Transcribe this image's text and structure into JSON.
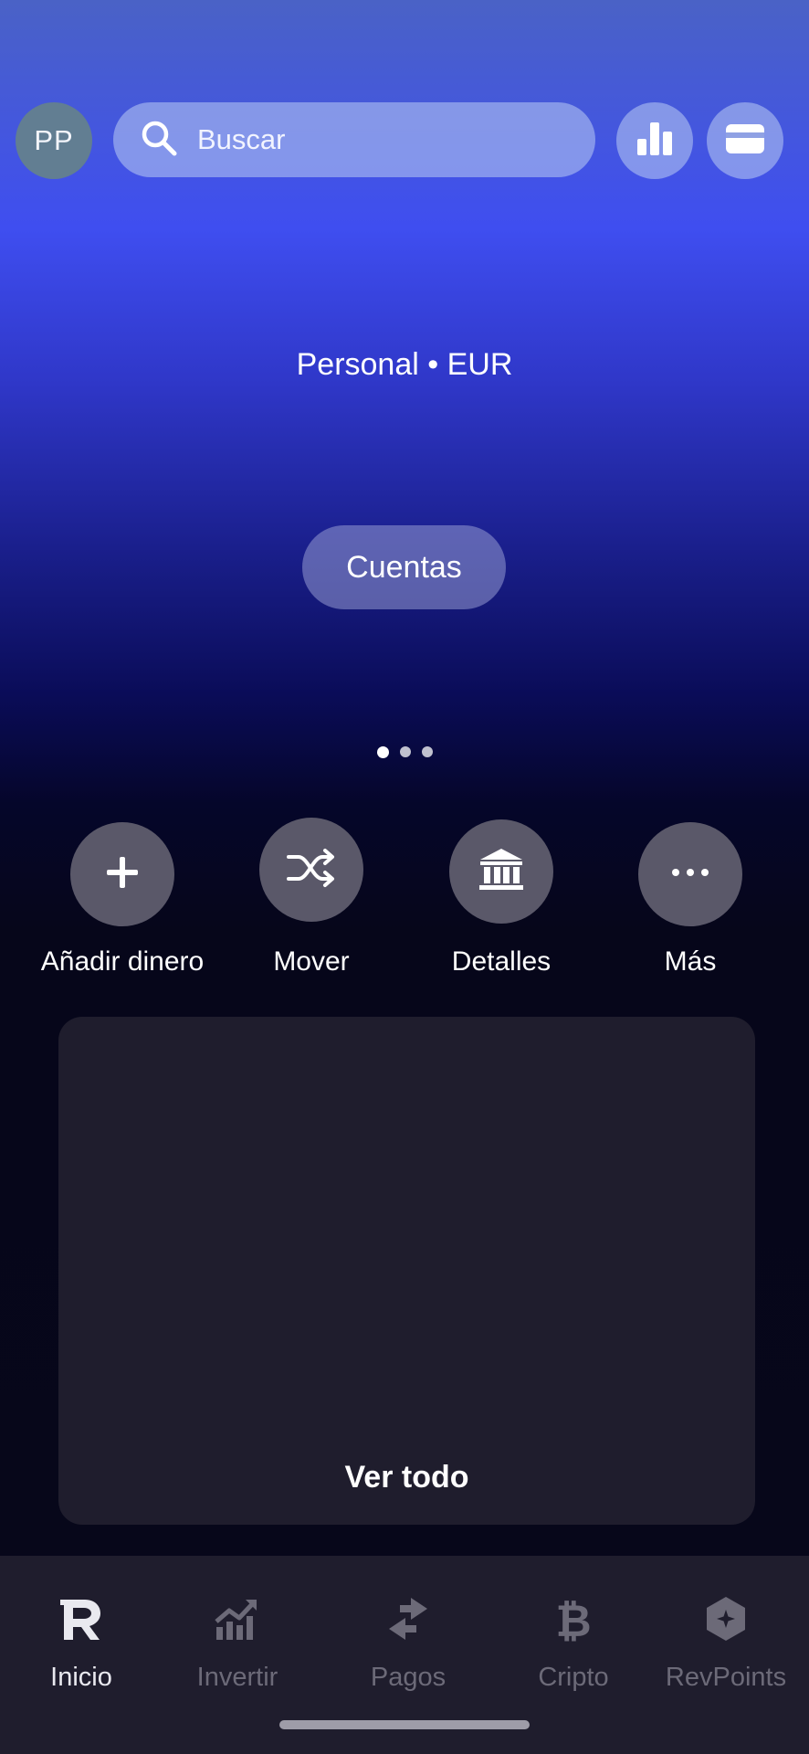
{
  "header": {
    "avatar_initials": "PP",
    "search": {
      "placeholder": "Buscar",
      "icon": "search-icon"
    },
    "stats_button_icon": "bar-chart-icon",
    "cards_button_icon": "card-icon"
  },
  "account": {
    "label": "Personal • EUR",
    "accounts_button": "Cuentas",
    "pager": {
      "pages": 3,
      "active_index": 0
    }
  },
  "actions": [
    {
      "label": "Añadir dinero",
      "icon": "plus-icon"
    },
    {
      "label": "Mover",
      "icon": "shuffle-icon"
    },
    {
      "label": "Detalles",
      "icon": "bank-icon"
    },
    {
      "label": "Más",
      "icon": "more-icon"
    }
  ],
  "transactions_panel": {
    "see_all": "Ver todo"
  },
  "tabbar": {
    "active": "Inicio",
    "tabs": [
      {
        "label": "Inicio",
        "icon": "revolut-r-icon"
      },
      {
        "label": "Invertir",
        "icon": "invest-chart-icon"
      },
      {
        "label": "Pagos",
        "icon": "transfer-arrows-icon"
      },
      {
        "label": "Cripto",
        "icon": "bitcoin-icon"
      },
      {
        "label": "RevPoints",
        "icon": "revpoints-hexagon-icon"
      }
    ]
  },
  "colors": {
    "accent_blue": "#3f4ef0",
    "panel": "#1f1d2d",
    "action_circle": "#5a5869",
    "tab_inactive": "#6c6a78"
  }
}
